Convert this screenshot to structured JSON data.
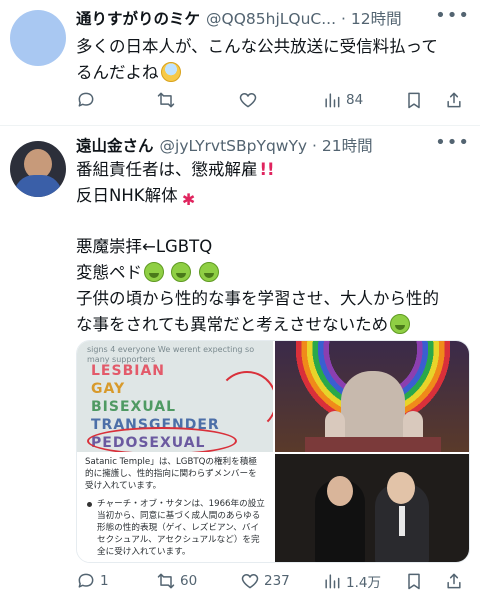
{
  "tweets": [
    {
      "name": "通りすがりのミケ",
      "handle": "@QQ85hjLQuC...",
      "time": "12時間",
      "separator": "·",
      "lines": [
        "多くの日本人が、こんな公共放送に受信料払って",
        "るんだよね"
      ],
      "emoji": "scream-face",
      "stats": {
        "reply": "",
        "retweet": "",
        "like": "",
        "views": "84"
      }
    },
    {
      "name": "遠山金さん",
      "handle": "@jyLYrvtSBpYqwYy",
      "time": "21時間",
      "separator": "·",
      "lines": [
        "番組責任者は、懲戒解雇",
        "反日NHK解体",
        "悪魔崇拝←LGBTQ",
        "変態ペド",
        "子供の頃から性的な事を学習させ、大人から性的",
        "な事をされても異常だと考えさせないため"
      ],
      "media": {
        "sign_caption": "signs 4 everyone We werent expecting so many supporters",
        "sign_words": [
          "LESBIAN",
          "GAY",
          "BISEXUAL",
          "TRANSGENDER",
          "PEDOSEXUAL"
        ],
        "doc_text_top": "Satanic Temple」は、LGBTQの権利を積極的に擁護し、性的指向に関わらずメンバーを受け入れています。",
        "doc_bullet": "チャーチ・オブ・サタンは、1966年の設立当初から、同意に基づく成人間のあらゆる形態の性的表現（ゲイ、レズビアン、バイセクシュアル、アセクシュアルなど）を完全に受け入れています。"
      },
      "stats": {
        "reply": "1",
        "retweet": "60",
        "like": "237",
        "views": "1.4万"
      }
    }
  ],
  "icons": {
    "reply": "reply-icon",
    "retweet": "retweet-icon",
    "like": "heart-icon",
    "views": "views-icon",
    "bookmark": "bookmark-icon",
    "share": "share-icon",
    "more": "more-icon"
  },
  "colors": {
    "text": "#0f1419",
    "muted": "#536471",
    "divider": "#eff3f4"
  }
}
